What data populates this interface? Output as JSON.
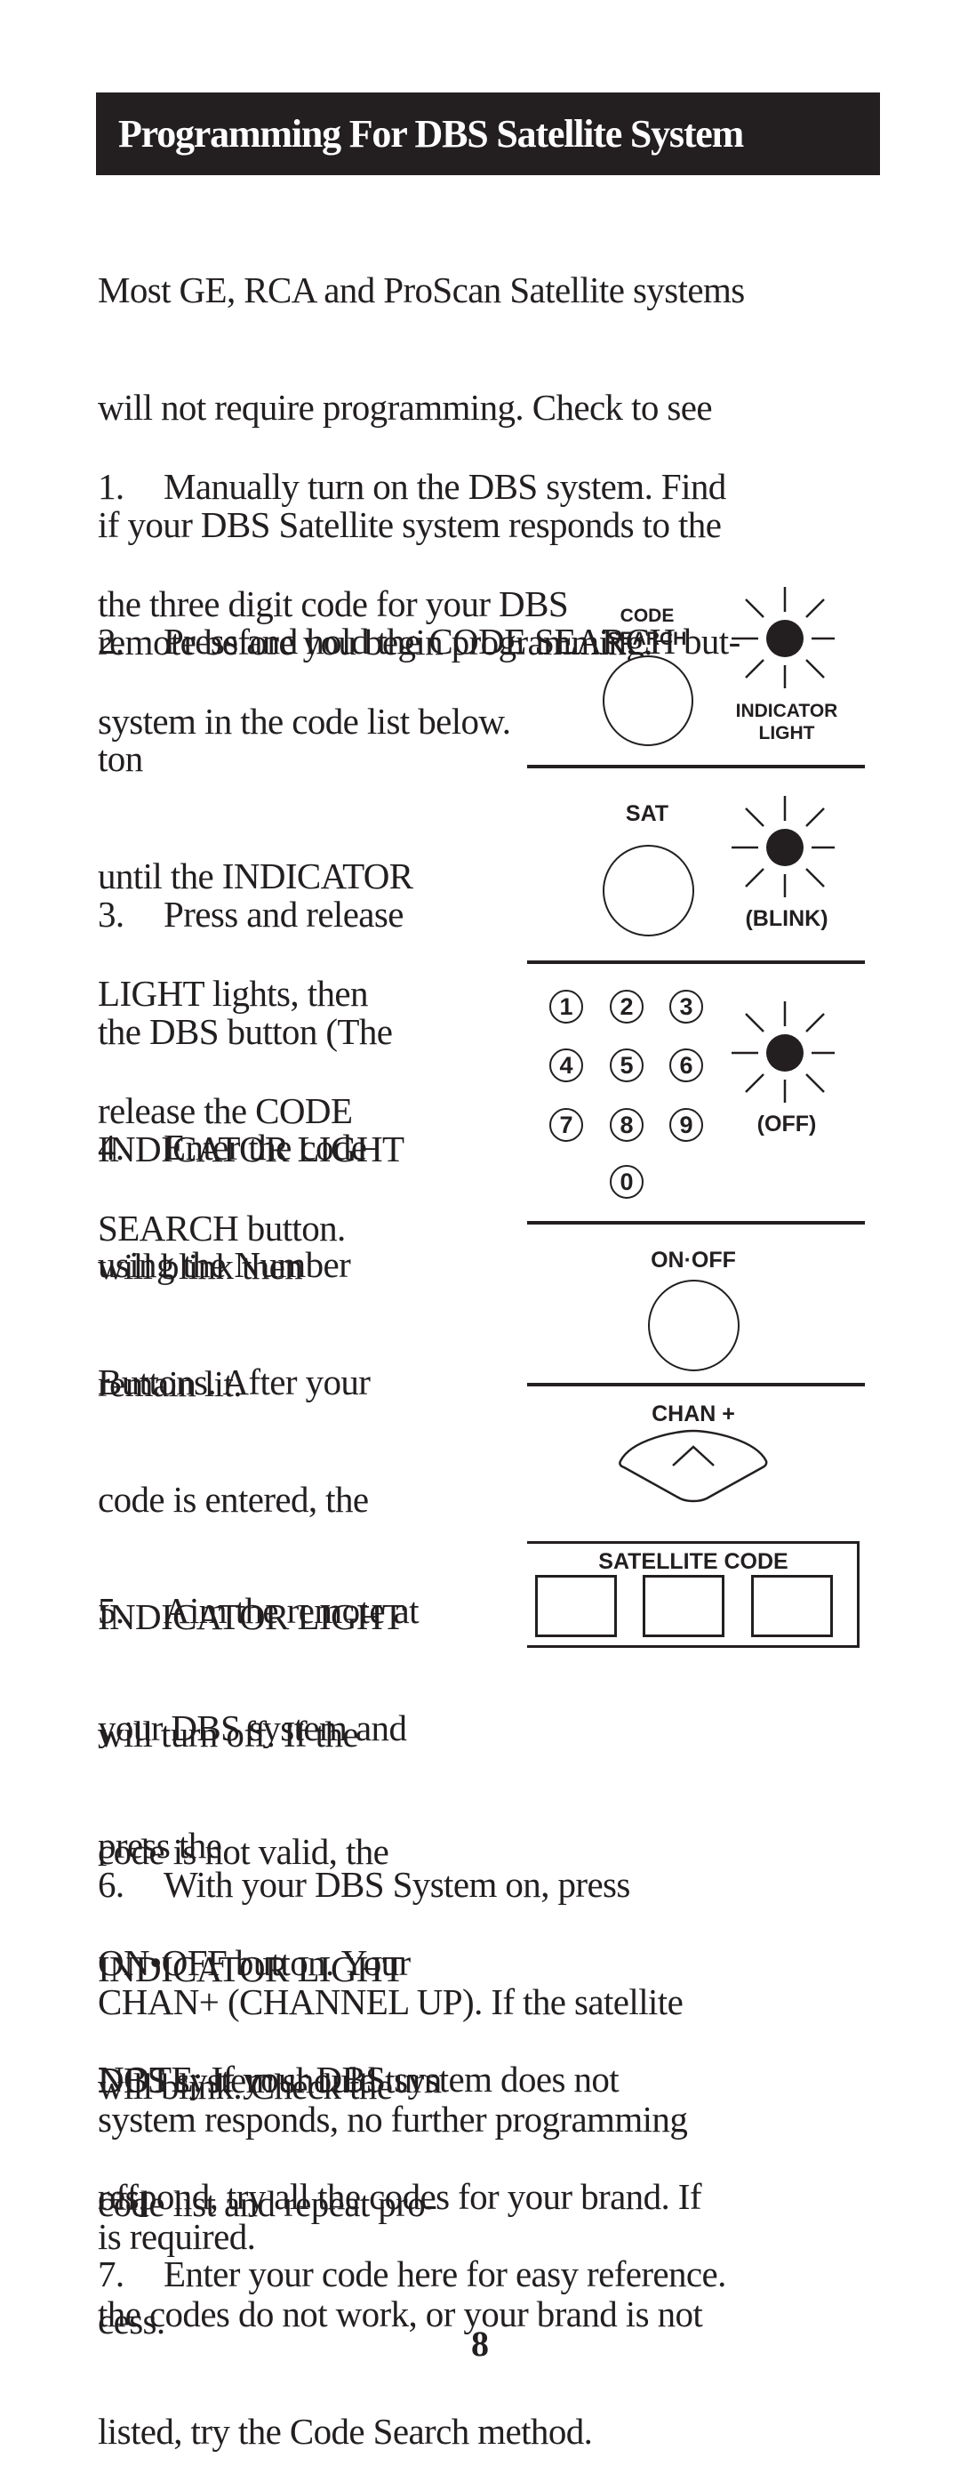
{
  "header": {
    "title": "Programming For DBS Satellite System"
  },
  "intro": {
    "lines": [
      "Most GE, RCA and ProScan Satellite systems",
      "will not require programming. Check to see",
      "if your DBS Satellite system responds to the",
      "remote before you begin programming."
    ]
  },
  "steps": [
    {
      "number": "1.",
      "lines": [
        "Manually turn on the DBS system. Find",
        "the three digit code for your DBS",
        "system in the code list below."
      ]
    },
    {
      "number": "2.",
      "lines": [
        "Press and hold the CODE SEARCH but-",
        "ton",
        "until the INDICATOR",
        "LIGHT lights, then",
        "release the CODE",
        "SEARCH button."
      ]
    },
    {
      "number": "3.",
      "lines": [
        "Press and release",
        "the DBS button (The",
        "INDICATOR LIGHT",
        "will blink then",
        "remain lit."
      ]
    },
    {
      "number": "4.",
      "lines": [
        "Enter the code",
        "using the Number",
        "Buttons. After your",
        "code is entered, the",
        "INDICATOR LIGHT",
        "will turn off. If the",
        "code is not valid, the",
        "INDICATOR LIGHT",
        "will blink. Check the",
        "code list and repeat pro-",
        "cess."
      ]
    },
    {
      "number": "5.",
      "lines": [
        "Aim the remote at",
        "your DBS system and",
        "press the",
        "ON•OFF button. Your",
        "DBS system should turn",
        "off."
      ]
    },
    {
      "number": "6.",
      "lines": [
        "With your DBS System on, press",
        "CHAN+ (CHANNEL UP). If the satellite",
        "system responds, no further programming",
        "is required."
      ]
    },
    {
      "number": "7.",
      "lines": [
        "Enter your code here for easy reference."
      ]
    }
  ],
  "note": {
    "lines": [
      "NOTE: If your DBS system does not",
      "respond, try all the codes for your brand. If",
      "the codes do not work, or your brand is not",
      "listed, try the Code Search method."
    ]
  },
  "diagram": {
    "code_search": {
      "label_line1": "CODE",
      "label_line2": "SEARCH",
      "indicator_line1": "INDICATOR",
      "indicator_line2": "LIGHT",
      "light_icon": "indicator-light-on"
    },
    "sat": {
      "label": "SAT",
      "indicator_state": "(BLINK)",
      "light_icon": "indicator-light-blink"
    },
    "number_pad": {
      "keys": [
        "1",
        "2",
        "3",
        "4",
        "5",
        "6",
        "7",
        "8",
        "9",
        "0"
      ],
      "indicator_state": "(OFF)",
      "light_icon": "indicator-light-off"
    },
    "on_off": {
      "label": "ON·OFF"
    },
    "chan_up": {
      "label": "CHAN +",
      "icon": "chevron-up-icon"
    },
    "satellite_code": {
      "label": "SATELLITE CODE",
      "cells": [
        "",
        "",
        ""
      ]
    }
  },
  "footer": {
    "page_number": "8"
  },
  "colors": {
    "ink": "#231f20",
    "paper": "#ffffff"
  }
}
